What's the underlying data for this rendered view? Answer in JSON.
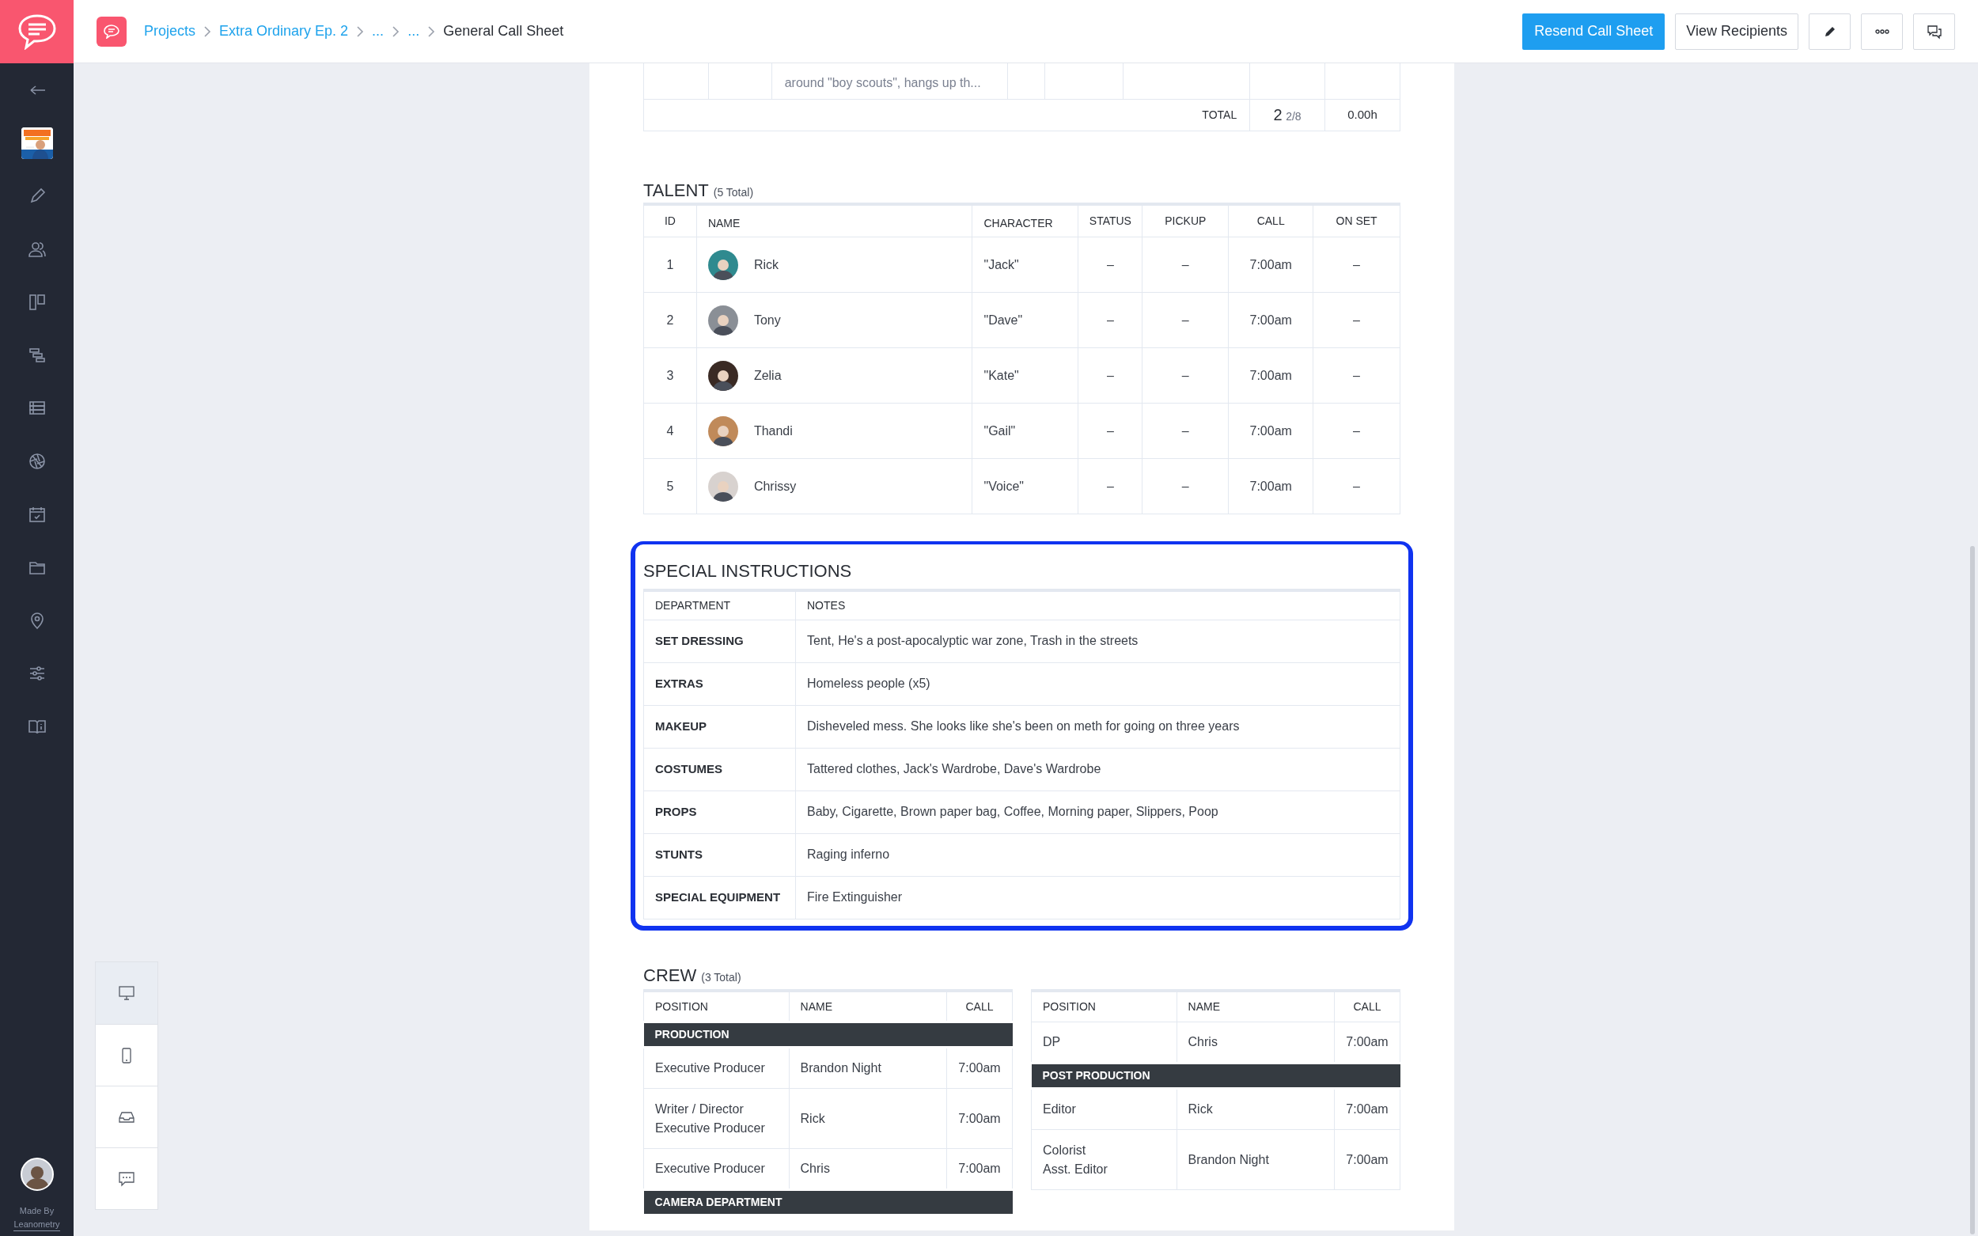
{
  "header": {
    "breadcrumbs": [
      {
        "label": "Projects",
        "link": true
      },
      {
        "label": "Extra Ordinary Ep. 2",
        "link": true
      },
      {
        "label": "...",
        "link": true
      },
      {
        "label": "...",
        "link": true
      },
      {
        "label": "General Call Sheet",
        "link": false
      }
    ],
    "buttons": [
      {
        "kind": "primary",
        "label": "Resend Call Sheet"
      },
      {
        "kind": "secondary",
        "label": "View Recipients"
      },
      {
        "kind": "edit"
      },
      {
        "kind": "more"
      },
      {
        "kind": "comments"
      }
    ]
  },
  "sidebar": {
    "items": [
      {
        "kind": "back"
      },
      {
        "kind": "project"
      },
      {
        "kind": "edit"
      },
      {
        "kind": "people"
      },
      {
        "kind": "board"
      },
      {
        "kind": "timeline"
      },
      {
        "kind": "list"
      },
      {
        "kind": "aperture"
      },
      {
        "kind": "calendar"
      },
      {
        "kind": "folder"
      },
      {
        "kind": "location"
      },
      {
        "kind": "settings"
      },
      {
        "kind": "book"
      }
    ],
    "made_by": "Made By",
    "company": "Leanometry"
  },
  "view_panel": {
    "items": [
      {
        "kind": "desktop",
        "selected": true
      },
      {
        "kind": "mobile",
        "selected": false
      },
      {
        "kind": "inbox",
        "selected": false
      },
      {
        "kind": "chat",
        "selected": false
      }
    ]
  },
  "breakdown": {
    "partial_notes": "around \"boy scouts\", hangs up th...",
    "total_label": "TOTAL",
    "pages": "2",
    "pages_fraction": "2/8",
    "hours": "0.00h"
  },
  "talent": {
    "title": "TALENT",
    "count": "(5 Total)",
    "columns": [
      "ID",
      "NAME",
      "CHARACTER",
      "STATUS",
      "PICKUP",
      "CALL",
      "ON SET"
    ],
    "rows": [
      {
        "id": "1",
        "name": "Rick",
        "character": "\"Jack\"",
        "status": "–",
        "pickup": "–",
        "call": "7:00am",
        "on_set": "–"
      },
      {
        "id": "2",
        "name": "Tony",
        "character": "\"Dave\"",
        "status": "–",
        "pickup": "–",
        "call": "7:00am",
        "on_set": "–"
      },
      {
        "id": "3",
        "name": "Zelia",
        "character": "\"Kate\"",
        "status": "–",
        "pickup": "–",
        "call": "7:00am",
        "on_set": "–"
      },
      {
        "id": "4",
        "name": "Thandi",
        "character": "\"Gail\"",
        "status": "–",
        "pickup": "–",
        "call": "7:00am",
        "on_set": "–"
      },
      {
        "id": "5",
        "name": "Chrissy",
        "character": "\"Voice\"",
        "status": "–",
        "pickup": "–",
        "call": "7:00am",
        "on_set": "–"
      }
    ]
  },
  "special_instructions": {
    "title": "SPECIAL INSTRUCTIONS",
    "highlighted": true,
    "columns": [
      "DEPARTMENT",
      "NOTES"
    ],
    "rows": [
      {
        "department": "SET DRESSING",
        "notes": "Tent, He's a post-apocalyptic war zone, Trash in the streets"
      },
      {
        "department": "EXTRAS",
        "notes": "Homeless people (x5)"
      },
      {
        "department": "MAKEUP",
        "notes": "Disheveled mess. She looks like she's been on meth for going on three years"
      },
      {
        "department": "COSTUMES",
        "notes": "Tattered clothes, Jack's Wardrobe, Dave's Wardrobe"
      },
      {
        "department": "PROPS",
        "notes": "Baby, Cigarette, Brown paper bag, Coffee, Morning paper, Slippers, Poop"
      },
      {
        "department": "STUNTS",
        "notes": "Raging inferno"
      },
      {
        "department": "SPECIAL EQUIPMENT",
        "notes": "Fire Extinguisher"
      }
    ]
  },
  "crew": {
    "title": "CREW",
    "count": "(3 Total)",
    "tables": [
      {
        "columns": [
          "POSITION",
          "NAME",
          "CALL"
        ],
        "rows": [
          {
            "kind": "group",
            "label": "PRODUCTION"
          },
          {
            "kind": "person",
            "position": "Executive Producer",
            "name": "Brandon Night",
            "call": "7:00am"
          },
          {
            "kind": "person",
            "position": "Writer / Director\nExecutive Producer",
            "name": "Rick",
            "call": "7:00am"
          },
          {
            "kind": "person",
            "position": "Executive Producer",
            "name": "Chris",
            "call": "7:00am"
          },
          {
            "kind": "group",
            "label": "CAMERA DEPARTMENT"
          }
        ]
      },
      {
        "columns": [
          "POSITION",
          "NAME",
          "CALL"
        ],
        "rows": [
          {
            "kind": "person",
            "position": "DP",
            "name": "Chris",
            "call": "7:00am"
          },
          {
            "kind": "group",
            "label": "POST PRODUCTION"
          },
          {
            "kind": "person",
            "position": "Editor",
            "name": "Rick",
            "call": "7:00am"
          },
          {
            "kind": "person",
            "position": "Colorist\nAsst. Editor",
            "name": "Brandon Night",
            "call": "7:00am"
          }
        ]
      }
    ]
  }
}
